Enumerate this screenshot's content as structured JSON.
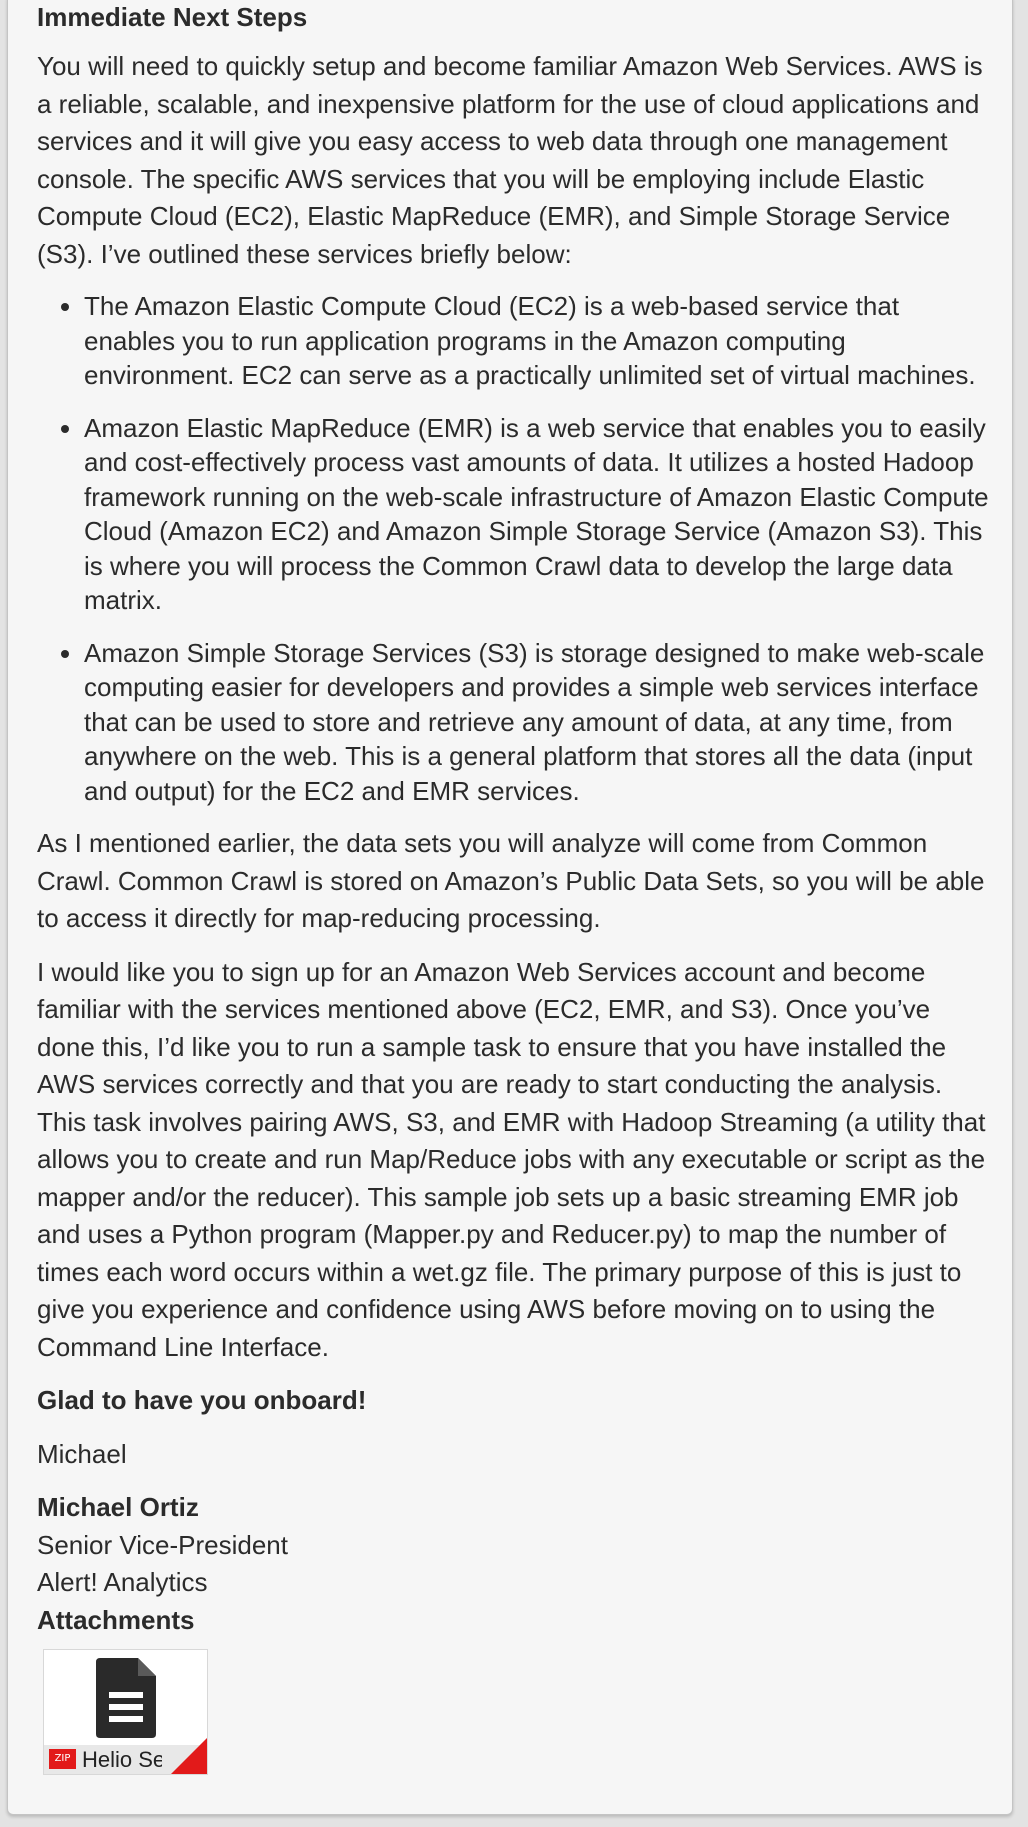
{
  "email": {
    "heading": "Immediate Next Steps",
    "intro": "You will need to quickly setup and become familiar Amazon Web Services. AWS is a reliable, scalable, and inexpensive platform for the use of cloud applications and services and it will give you easy access to web data through one management console. The specific AWS services that you will be employing include Elastic Compute Cloud (EC2), Elastic MapReduce (EMR), and Simple Storage Service (S3). I’ve outlined these services briefly below:",
    "bullets": [
      "The Amazon Elastic Compute Cloud (EC2) is a web-based service that enables you to run application programs in the Amazon computing environment. EC2 can serve as a practically unlimited set of virtual machines.",
      "Amazon Elastic MapReduce (EMR) is a web service that enables you to easily and cost-effectively process vast amounts of data. It utilizes a hosted Hadoop framework running on the web-scale infrastructure of Amazon Elastic Compute Cloud (Amazon EC2) and Amazon Simple Storage Service (Amazon S3). This is where you will process the Common Crawl data to develop the large data matrix.",
      "Amazon Simple Storage Services (S3) is storage designed to make web-scale computing easier for developers and provides a simple web services interface that can be used to store and retrieve any amount of data, at any time, from anywhere on the web. This is a general platform that stores all the data (input and output) for the EC2 and EMR services."
    ],
    "paragraph_common_crawl": "As I mentioned earlier, the data sets you will analyze will come from Common Crawl. Common Crawl is stored on Amazon’s Public Data Sets, so you will be able to access it directly for map-reducing processing.",
    "paragraph_signup": "I would like you to sign up for an Amazon Web Services account and become familiar with the services mentioned above (EC2, EMR, and S3). Once you’ve done this, I’d like you to run a sample task to ensure that you have installed the AWS services correctly and that you are ready to start conducting the analysis. This task involves pairing AWS, S3, and EMR with Hadoop Streaming (a utility that allows you to create and run Map/Reduce jobs with any executable or script as the mapper and/or the reducer). This sample job sets up a basic streaming EMR job and uses a Python program (Mapper.py and Reducer.py) to map the number of times each word occurs within a wet.gz file. The primary purpose of this is just to give you experience and confidence using AWS before moving on to using the Command Line Interface.",
    "closing": "Glad to have you onboard!",
    "sign_off_name": "Michael",
    "signature": {
      "name": "Michael Ortiz",
      "title": "Senior Vice-President",
      "company": "Alert! Analytics"
    }
  },
  "attachments": {
    "label": "Attachments",
    "items": [
      {
        "badge": "ZIP",
        "name": "Helio Se",
        "icon": "document-icon",
        "badge_color": "#e21a1a"
      }
    ]
  }
}
